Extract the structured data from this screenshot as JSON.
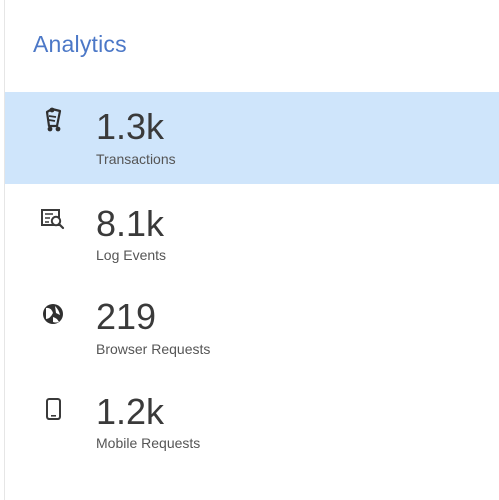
{
  "panel": {
    "title": "Analytics"
  },
  "stats": [
    {
      "icon": "transactions-icon",
      "value": "1.3k",
      "label": "Transactions",
      "selected": true
    },
    {
      "icon": "log-events-icon",
      "value": "8.1k",
      "label": "Log Events",
      "selected": false
    },
    {
      "icon": "browser-requests-icon",
      "value": "219",
      "label": "Browser Requests",
      "selected": false
    },
    {
      "icon": "mobile-requests-icon",
      "value": "1.2k",
      "label": "Mobile Requests",
      "selected": false
    }
  ],
  "colors": {
    "title": "#4c78c7",
    "selected_background": "#cfe5fb",
    "value_text": "#3a3a3a",
    "label_text": "#555555"
  }
}
